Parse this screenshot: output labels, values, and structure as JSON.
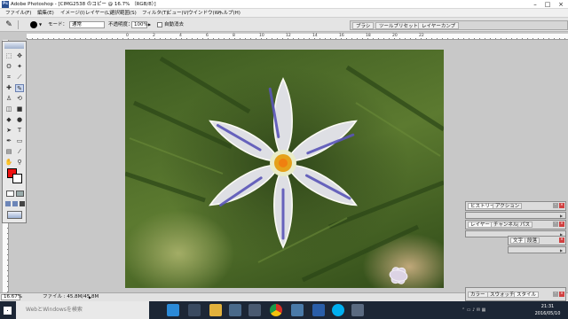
{
  "window": {
    "title": "Adobe Photoshop - [CIMG2538 のコピー @ 16.7% （RGB/8）]",
    "minimize": "–",
    "maximize": "□",
    "close": "×"
  },
  "menu": [
    "ファイル(F)",
    "編集(E)",
    "イメージ(I)",
    "レイヤー(L)",
    "選択範囲(S)",
    "フィルタ(T)",
    "ビュー(V)",
    "ウインドウ(W)",
    "ヘルプ(H)"
  ],
  "options": {
    "mode_label": "モード：",
    "mode_value": "通常",
    "opacity_label": "不透明度：",
    "opacity_value": "100%",
    "autoerase_label": "自動消去"
  },
  "palette_well_tabs": [
    "ブラシ",
    "ツールプリセット",
    "レイヤーカンプ"
  ],
  "ruler_ticks": [
    "0",
    "2",
    "4",
    "6",
    "8",
    "10",
    "12",
    "14",
    "16",
    "18",
    "20",
    "22"
  ],
  "status": {
    "zoom": "16.67%",
    "file_info": "ファイル : 45.8M/45.8M"
  },
  "panels": {
    "history": {
      "tabs": [
        "ヒストリー",
        "アクション"
      ]
    },
    "layers": {
      "tabs": [
        "レイヤー",
        "チャンネル",
        "パス"
      ]
    },
    "text": {
      "tabs": [
        "文字",
        "段落"
      ]
    },
    "color": {
      "tabs": [
        "カラー",
        "スウォッチ",
        "スタイル"
      ]
    }
  },
  "taskbar": {
    "search_placeholder": "WebとWindowsを検索",
    "time": "21:31",
    "date": "2016/05/10"
  },
  "colors": {
    "foreground": "#ee1111",
    "background": "#ffffff",
    "taskbar": "#1c2635",
    "close_red": "#d04040"
  }
}
